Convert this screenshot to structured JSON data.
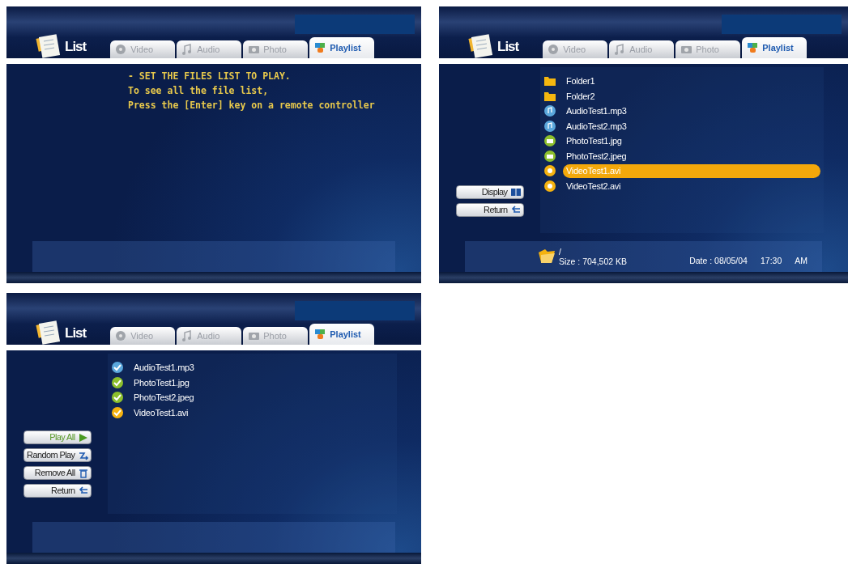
{
  "screens": [
    {
      "kind": "message",
      "title": "List",
      "tabs": [
        {
          "label": "Video",
          "kind": "video",
          "selected": false
        },
        {
          "label": "Audio",
          "kind": "audio",
          "selected": false
        },
        {
          "label": "Photo",
          "kind": "photo",
          "selected": false
        },
        {
          "label": "Playlist",
          "kind": "playlist",
          "selected": true
        }
      ],
      "message": [
        "- SET THE FILES LIST TO PLAY.",
        "To see all the file list,",
        "Press the [Enter] key on a remote controller"
      ]
    },
    {
      "kind": "browser",
      "title": "List",
      "tabs": [
        {
          "label": "Video",
          "kind": "video",
          "selected": false
        },
        {
          "label": "Audio",
          "kind": "audio",
          "selected": false
        },
        {
          "label": "Photo",
          "kind": "photo",
          "selected": false
        },
        {
          "label": "Playlist",
          "kind": "playlist",
          "selected": true
        }
      ],
      "buttons": [
        {
          "label": "Display",
          "kind": "display",
          "selected": false
        },
        {
          "label": "Return",
          "kind": "return",
          "selected": false
        }
      ],
      "files": [
        {
          "name": "Folder1",
          "kind": "folder",
          "selected": false
        },
        {
          "name": "Folder2",
          "kind": "folder",
          "selected": false
        },
        {
          "name": "AudioTest1.mp3",
          "kind": "audio",
          "selected": false
        },
        {
          "name": "AudioTest2.mp3",
          "kind": "audio",
          "selected": false
        },
        {
          "name": "PhotoTest1.jpg",
          "kind": "photo",
          "selected": false
        },
        {
          "name": "PhotoTest2.jpeg",
          "kind": "photo",
          "selected": false
        },
        {
          "name": "VideoTest1.avi",
          "kind": "video",
          "selected": true
        },
        {
          "name": "VideoTest2.avi",
          "kind": "video",
          "selected": false
        }
      ],
      "footer": {
        "path": "/",
        "size": "Size : 704,502 KB",
        "date": "Date : 08/05/04",
        "time": "17:30",
        "meridiem": "AM"
      }
    },
    {
      "kind": "playlist",
      "title": "List",
      "tabs": [
        {
          "label": "Video",
          "kind": "video",
          "selected": false
        },
        {
          "label": "Audio",
          "kind": "audio",
          "selected": false
        },
        {
          "label": "Photo",
          "kind": "photo",
          "selected": false
        },
        {
          "label": "Playlist",
          "kind": "playlist",
          "selected": true
        }
      ],
      "buttons": [
        {
          "label": "Play All",
          "kind": "play",
          "selected": true
        },
        {
          "label": "Random Play",
          "kind": "shuffle",
          "selected": false
        },
        {
          "label": "Remove All",
          "kind": "trash",
          "selected": false
        },
        {
          "label": "Return",
          "kind": "return",
          "selected": false
        }
      ],
      "files": [
        {
          "name": "AudioTest1.mp3",
          "kind": "audio",
          "selected": false
        },
        {
          "name": "PhotoTest1.jpg",
          "kind": "photo",
          "selected": false
        },
        {
          "name": "PhotoTest2.jpeg",
          "kind": "photo",
          "selected": false
        },
        {
          "name": "VideoTest1.avi",
          "kind": "video",
          "selected": false
        }
      ]
    }
  ]
}
